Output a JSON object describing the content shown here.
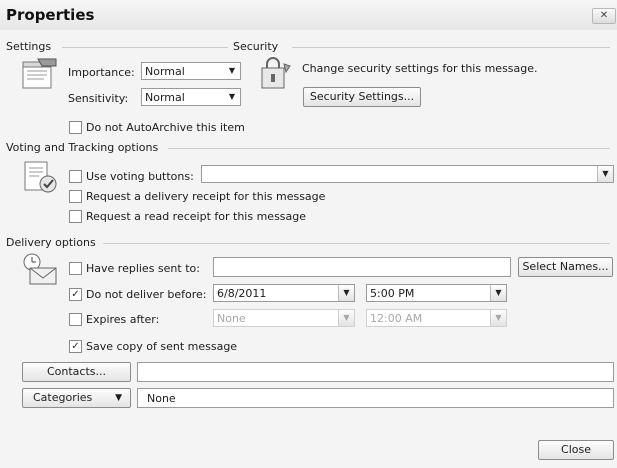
{
  "window": {
    "title": "Properties",
    "close_glyph": "✕"
  },
  "settings": {
    "heading": "Settings",
    "importance_label": "Importance:",
    "importance_value": "Normal",
    "sensitivity_label": "Sensitivity:",
    "sensitivity_value": "Normal",
    "autoarchive_label": "Do not AutoArchive this item",
    "autoarchive_checked": false
  },
  "security": {
    "heading": "Security",
    "description": "Change security settings for this message.",
    "button_label": "Security Settings..."
  },
  "voting": {
    "heading": "Voting and Tracking options",
    "use_voting_label": "Use voting buttons:",
    "use_voting_checked": false,
    "voting_value": "",
    "delivery_receipt_label": "Request a delivery receipt for this message",
    "delivery_receipt_checked": false,
    "read_receipt_label": "Request a read receipt for this message",
    "read_receipt_checked": false
  },
  "delivery": {
    "heading": "Delivery options",
    "replies_label": "Have replies sent to:",
    "replies_checked": false,
    "replies_value": "",
    "select_names_label": "Select Names...",
    "do_not_deliver_label": "Do not deliver before:",
    "do_not_deliver_checked": true,
    "deliver_date": "6/8/2011",
    "deliver_time": "5:00 PM",
    "expires_label": "Expires after:",
    "expires_checked": false,
    "expires_date": "None",
    "expires_time": "12:00 AM",
    "save_copy_label": "Save copy of sent message",
    "save_copy_checked": true
  },
  "contacts": {
    "button_label": "Contacts...",
    "value": ""
  },
  "categories": {
    "button_label": "Categories",
    "value": "None"
  },
  "footer": {
    "close_label": "Close"
  },
  "glyphs": {
    "check": "✓",
    "dropdown": "▼"
  }
}
